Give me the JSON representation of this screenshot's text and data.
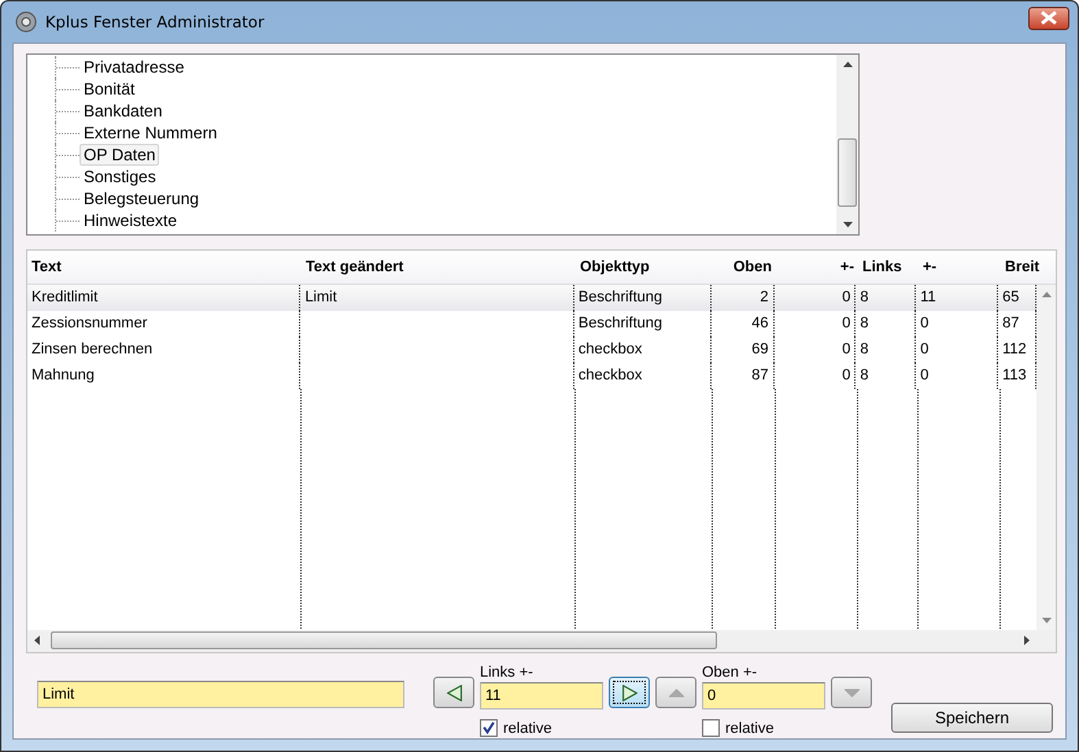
{
  "window": {
    "title": "Kplus Fenster Administrator"
  },
  "tree": {
    "items": [
      {
        "label": "Privatadresse",
        "selected": false
      },
      {
        "label": "Bonität",
        "selected": false
      },
      {
        "label": "Bankdaten",
        "selected": false
      },
      {
        "label": "Externe Nummern",
        "selected": false
      },
      {
        "label": "OP Daten",
        "selected": true
      },
      {
        "label": "Sonstiges",
        "selected": false
      },
      {
        "label": "Belegsteuerung",
        "selected": false
      },
      {
        "label": "Hinweistexte",
        "selected": false
      }
    ]
  },
  "table": {
    "columns": [
      "Text",
      "Text geändert",
      "Objekttyp",
      "Oben",
      "+-",
      "Links",
      "+-",
      "Breit"
    ],
    "rows": [
      {
        "cells": [
          "Kreditlimit",
          "Limit",
          "Beschriftung",
          "2",
          "0",
          "8",
          "11",
          "65"
        ],
        "selected": true
      },
      {
        "cells": [
          "Zessionsnummer",
          "",
          "Beschriftung",
          "46",
          "0",
          "8",
          "0",
          "87"
        ],
        "selected": false
      },
      {
        "cells": [
          "Zinsen berechnen",
          "",
          "checkbox",
          "69",
          "0",
          "8",
          "0",
          "112"
        ],
        "selected": false
      },
      {
        "cells": [
          "Mahnung",
          "",
          "checkbox",
          "87",
          "0",
          "8",
          "0",
          "113"
        ],
        "selected": false
      }
    ]
  },
  "text_field": {
    "value": "Limit"
  },
  "links": {
    "label": "Links +-",
    "value": "11",
    "relative": {
      "label": "relative",
      "checked": true
    }
  },
  "oben": {
    "label": "Oben +-",
    "value": "0",
    "relative": {
      "label": "relative",
      "checked": false
    }
  },
  "arrow_buttons": [
    {
      "kind": "left",
      "disabled": false,
      "focused": false
    },
    {
      "kind": "right",
      "disabled": false,
      "focused": true
    },
    {
      "kind": "up",
      "disabled": true,
      "focused": false
    },
    {
      "kind": "down",
      "disabled": true,
      "focused": false
    }
  ],
  "save_button": {
    "label": "Speichern"
  }
}
